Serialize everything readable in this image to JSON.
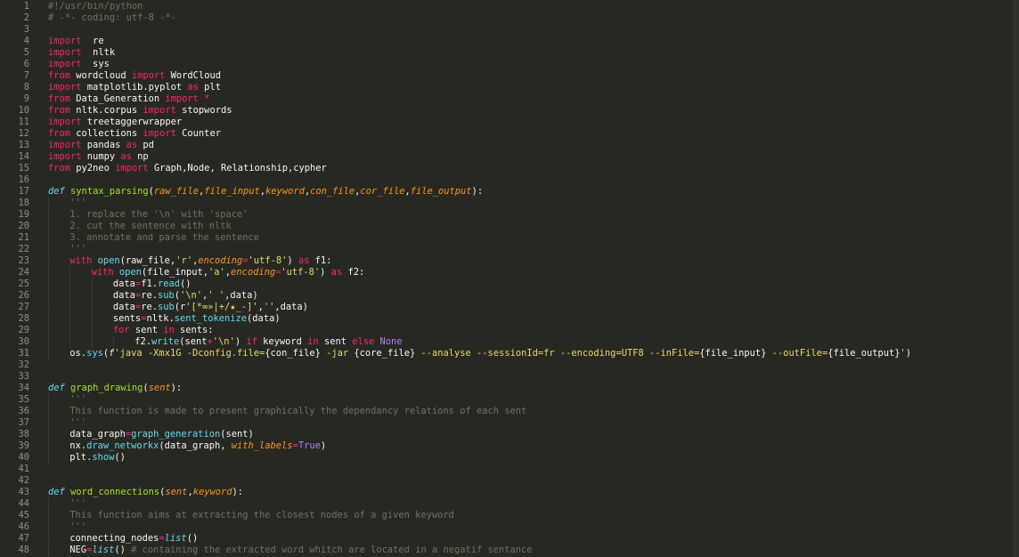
{
  "editor": {
    "theme_colors": {
      "background": "#272822",
      "gutter_text": "#90908a",
      "keyword": "#f92672",
      "function": "#a6e22e",
      "string": "#e6db74",
      "comment": "#75715e",
      "parameter": "#fd971f",
      "builtin": "#66d9ef",
      "constant": "#ae81ff",
      "text": "#f8f8f2"
    },
    "lines": [
      {
        "n": "1",
        "indent": 0,
        "tokens": [
          [
            "cm",
            "#!/usr/bin/python"
          ]
        ]
      },
      {
        "n": "2",
        "indent": 0,
        "tokens": [
          [
            "cm",
            "# -*- coding: utf-8 -*-"
          ]
        ]
      },
      {
        "n": "3",
        "indent": 0,
        "tokens": []
      },
      {
        "n": "4",
        "indent": 0,
        "tokens": [
          [
            "kw",
            "import"
          ],
          [
            "",
            "  re"
          ]
        ]
      },
      {
        "n": "5",
        "indent": 0,
        "tokens": [
          [
            "kw",
            "import"
          ],
          [
            "",
            "  nltk"
          ]
        ]
      },
      {
        "n": "6",
        "indent": 0,
        "tokens": [
          [
            "kw",
            "import"
          ],
          [
            "",
            "  sys"
          ]
        ]
      },
      {
        "n": "7",
        "indent": 0,
        "tokens": [
          [
            "kw",
            "from"
          ],
          [
            "",
            " wordcloud "
          ],
          [
            "kw",
            "import"
          ],
          [
            "",
            " WordCloud"
          ]
        ]
      },
      {
        "n": "8",
        "indent": 0,
        "tokens": [
          [
            "kw",
            "import"
          ],
          [
            "",
            " matplotlib.pyplot "
          ],
          [
            "kw",
            "as"
          ],
          [
            "",
            " plt"
          ]
        ]
      },
      {
        "n": "9",
        "indent": 0,
        "tokens": [
          [
            "kw",
            "from"
          ],
          [
            "",
            " Data_Generation "
          ],
          [
            "kw",
            "import"
          ],
          [
            "",
            " "
          ],
          [
            "kw",
            "*"
          ]
        ]
      },
      {
        "n": "10",
        "indent": 0,
        "tokens": [
          [
            "kw",
            "from"
          ],
          [
            "",
            " nltk.corpus "
          ],
          [
            "kw",
            "import"
          ],
          [
            "",
            " stopwords"
          ]
        ]
      },
      {
        "n": "11",
        "indent": 0,
        "tokens": [
          [
            "kw",
            "import"
          ],
          [
            "",
            " treetaggerwrapper"
          ]
        ]
      },
      {
        "n": "12",
        "indent": 0,
        "tokens": [
          [
            "kw",
            "from"
          ],
          [
            "",
            " collections "
          ],
          [
            "kw",
            "import"
          ],
          [
            "",
            " Counter"
          ]
        ]
      },
      {
        "n": "13",
        "indent": 0,
        "tokens": [
          [
            "kw",
            "import"
          ],
          [
            "",
            " pandas "
          ],
          [
            "kw",
            "as"
          ],
          [
            "",
            " pd"
          ]
        ]
      },
      {
        "n": "14",
        "indent": 0,
        "tokens": [
          [
            "kw",
            "import"
          ],
          [
            "",
            " numpy "
          ],
          [
            "kw",
            "as"
          ],
          [
            "",
            " np"
          ]
        ]
      },
      {
        "n": "15",
        "indent": 0,
        "tokens": [
          [
            "kw",
            "from"
          ],
          [
            "",
            " py2neo "
          ],
          [
            "kw",
            "import"
          ],
          [
            "",
            " Graph,Node, Relationship,cypher"
          ]
        ]
      },
      {
        "n": "16",
        "indent": 0,
        "tokens": []
      },
      {
        "n": "17",
        "indent": 0,
        "tokens": [
          [
            "def",
            "def"
          ],
          [
            "",
            " "
          ],
          [
            "fn",
            "syntax_parsing"
          ],
          [
            "",
            "("
          ],
          [
            "param",
            "raw_file"
          ],
          [
            "",
            ","
          ],
          [
            "param",
            "file_input"
          ],
          [
            "",
            ","
          ],
          [
            "param",
            "keyword"
          ],
          [
            "",
            ","
          ],
          [
            "param",
            "con_file"
          ],
          [
            "",
            ","
          ],
          [
            "param",
            "cor_file"
          ],
          [
            "",
            ","
          ],
          [
            "param",
            "file_output"
          ],
          [
            "",
            "):"
          ]
        ]
      },
      {
        "n": "18",
        "indent": 1,
        "tokens": [
          [
            "cm",
            "'''"
          ]
        ]
      },
      {
        "n": "19",
        "indent": 1,
        "tokens": [
          [
            "cm",
            "1. replace the '\\n' with 'space'"
          ]
        ]
      },
      {
        "n": "20",
        "indent": 1,
        "tokens": [
          [
            "cm",
            "2. cut the sentence with nltk"
          ]
        ]
      },
      {
        "n": "21",
        "indent": 1,
        "tokens": [
          [
            "cm",
            "3. annotate and parse the sentence"
          ]
        ]
      },
      {
        "n": "22",
        "indent": 1,
        "tokens": [
          [
            "cm",
            "'''"
          ]
        ]
      },
      {
        "n": "23",
        "indent": 1,
        "tokens": [
          [
            "kw",
            "with"
          ],
          [
            "",
            " "
          ],
          [
            "bi",
            "open"
          ],
          [
            "",
            "(raw_file,"
          ],
          [
            "str",
            "'r'"
          ],
          [
            "",
            ","
          ],
          [
            "param",
            "encoding"
          ],
          [
            "kw",
            "="
          ],
          [
            "str",
            "'utf-8'"
          ],
          [
            "",
            ") "
          ],
          [
            "kw",
            "as"
          ],
          [
            "",
            " f1:"
          ]
        ]
      },
      {
        "n": "24",
        "indent": 2,
        "tokens": [
          [
            "kw",
            "with"
          ],
          [
            "",
            " "
          ],
          [
            "bi",
            "open"
          ],
          [
            "",
            "(file_input,"
          ],
          [
            "str",
            "'a'"
          ],
          [
            "",
            ","
          ],
          [
            "param",
            "encoding"
          ],
          [
            "kw",
            "="
          ],
          [
            "str",
            "'utf-8'"
          ],
          [
            "",
            ") "
          ],
          [
            "kw",
            "as"
          ],
          [
            "",
            " f2:"
          ]
        ]
      },
      {
        "n": "25",
        "indent": 3,
        "tokens": [
          [
            "",
            "data"
          ],
          [
            "kw",
            "="
          ],
          [
            "",
            "f1."
          ],
          [
            "bi",
            "read"
          ],
          [
            "",
            "()"
          ]
        ]
      },
      {
        "n": "26",
        "indent": 3,
        "tokens": [
          [
            "",
            "data"
          ],
          [
            "kw",
            "="
          ],
          [
            "",
            "re."
          ],
          [
            "bi",
            "sub"
          ],
          [
            "",
            "("
          ],
          [
            "str",
            "'\\n'"
          ],
          [
            "",
            ","
          ],
          [
            "str",
            "' '"
          ],
          [
            "",
            ",data)"
          ]
        ]
      },
      {
        "n": "27",
        "indent": 3,
        "tokens": [
          [
            "",
            "data"
          ],
          [
            "kw",
            "="
          ],
          [
            "",
            "re."
          ],
          [
            "bi",
            "sub"
          ],
          [
            "",
            "(r"
          ],
          [
            "str",
            "'[*∞»|+/★_-]'"
          ],
          [
            "",
            ","
          ],
          [
            "str",
            "''"
          ],
          [
            "",
            ",data)"
          ]
        ]
      },
      {
        "n": "28",
        "indent": 3,
        "tokens": [
          [
            "",
            "sents"
          ],
          [
            "kw",
            "="
          ],
          [
            "",
            "nltk."
          ],
          [
            "bi",
            "sent_tokenize"
          ],
          [
            "",
            "(data)"
          ]
        ]
      },
      {
        "n": "29",
        "indent": 3,
        "tokens": [
          [
            "kw",
            "for"
          ],
          [
            "",
            " sent "
          ],
          [
            "kw",
            "in"
          ],
          [
            "",
            " sents:"
          ]
        ]
      },
      {
        "n": "30",
        "indent": 4,
        "tokens": [
          [
            "",
            "f2."
          ],
          [
            "bi",
            "write"
          ],
          [
            "",
            "(sent"
          ],
          [
            "kw",
            "+"
          ],
          [
            "str",
            "'\\n'"
          ],
          [
            "",
            ") "
          ],
          [
            "kw",
            "if"
          ],
          [
            "",
            " keyword "
          ],
          [
            "kw",
            "in"
          ],
          [
            "",
            " sent "
          ],
          [
            "kw",
            "else"
          ],
          [
            "",
            " "
          ],
          [
            "num",
            "None"
          ]
        ]
      },
      {
        "n": "31",
        "indent": 1,
        "tokens": [
          [
            "",
            "os."
          ],
          [
            "bi",
            "sys"
          ],
          [
            "",
            "("
          ],
          [
            "ital",
            "f"
          ],
          [
            "str",
            "'java -Xmx1G -Dconfig.file="
          ],
          [
            "",
            "{con_file}"
          ],
          [
            "str",
            " -jar "
          ],
          [
            "",
            "{core_file}"
          ],
          [
            "str",
            " --analyse --sessionId=fr --encoding=UTF8 --inFile="
          ],
          [
            "",
            "{file_input}"
          ],
          [
            "str",
            " --outFile="
          ],
          [
            "",
            "{file_output}"
          ],
          [
            "str",
            "'"
          ],
          [
            "",
            ")"
          ]
        ]
      },
      {
        "n": "32",
        "indent": 0,
        "tokens": []
      },
      {
        "n": "33",
        "indent": 0,
        "tokens": []
      },
      {
        "n": "34",
        "indent": 0,
        "tokens": [
          [
            "def",
            "def"
          ],
          [
            "",
            " "
          ],
          [
            "fn",
            "graph_drawing"
          ],
          [
            "",
            "("
          ],
          [
            "param",
            "sent"
          ],
          [
            "",
            "):"
          ]
        ]
      },
      {
        "n": "35",
        "indent": 1,
        "tokens": [
          [
            "cm",
            "'''"
          ]
        ]
      },
      {
        "n": "36",
        "indent": 1,
        "tokens": [
          [
            "cm",
            "This function is made to present graphically the dependancy relations of each sent"
          ]
        ]
      },
      {
        "n": "37",
        "indent": 1,
        "tokens": [
          [
            "cm",
            "'''"
          ]
        ]
      },
      {
        "n": "38",
        "indent": 1,
        "tokens": [
          [
            "",
            "data_graph"
          ],
          [
            "kw",
            "="
          ],
          [
            "bi",
            "graph_generation"
          ],
          [
            "",
            "(sent)"
          ]
        ]
      },
      {
        "n": "39",
        "indent": 1,
        "tokens": [
          [
            "",
            "nx."
          ],
          [
            "bi",
            "draw_networkx"
          ],
          [
            "",
            "(data_graph, "
          ],
          [
            "param",
            "with_labels"
          ],
          [
            "kw",
            "="
          ],
          [
            "num",
            "True"
          ],
          [
            "",
            ")"
          ]
        ]
      },
      {
        "n": "40",
        "indent": 1,
        "tokens": [
          [
            "",
            "plt."
          ],
          [
            "bi",
            "show"
          ],
          [
            "",
            "()"
          ]
        ]
      },
      {
        "n": "41",
        "indent": 0,
        "tokens": []
      },
      {
        "n": "42",
        "indent": 0,
        "tokens": []
      },
      {
        "n": "43",
        "indent": 0,
        "tokens": [
          [
            "def",
            "def"
          ],
          [
            "",
            " "
          ],
          [
            "fn",
            "word_connections"
          ],
          [
            "",
            "("
          ],
          [
            "param",
            "sent"
          ],
          [
            "",
            ","
          ],
          [
            "param",
            "keyword"
          ],
          [
            "",
            "):"
          ]
        ]
      },
      {
        "n": "44",
        "indent": 1,
        "tokens": [
          [
            "cm",
            "'''"
          ]
        ]
      },
      {
        "n": "45",
        "indent": 1,
        "tokens": [
          [
            "cm",
            "This function aims at extracting the closest nodes of a given keyword"
          ]
        ]
      },
      {
        "n": "46",
        "indent": 1,
        "tokens": [
          [
            "cm",
            "'''"
          ]
        ]
      },
      {
        "n": "47",
        "indent": 1,
        "tokens": [
          [
            "",
            "connecting_nodes"
          ],
          [
            "kw",
            "="
          ],
          [
            "def",
            "list"
          ],
          [
            "",
            "()"
          ]
        ]
      },
      {
        "n": "48",
        "indent": 1,
        "tokens": [
          [
            "",
            "NEG"
          ],
          [
            "kw",
            "="
          ],
          [
            "def",
            "list"
          ],
          [
            "",
            "() "
          ],
          [
            "cm",
            "# containing the extracted word whitch are located in a negatif sentance"
          ]
        ]
      }
    ]
  }
}
